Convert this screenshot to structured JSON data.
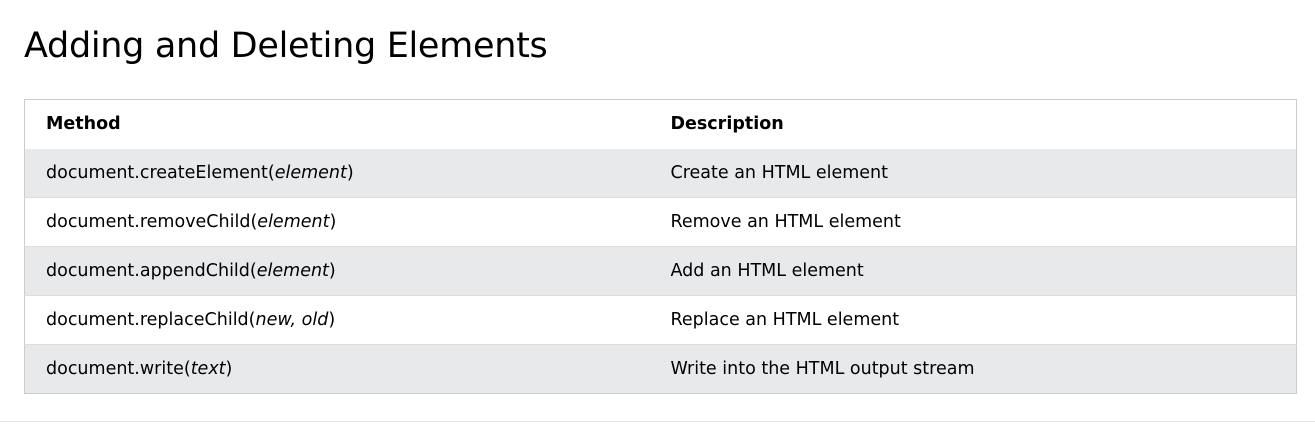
{
  "page": {
    "title": "Adding and Deleting Elements"
  },
  "table": {
    "headers": [
      "Method",
      "Description"
    ],
    "rows": [
      {
        "prefix": "document.createElement(",
        "arg": "element",
        "suffix": ")",
        "description": "Create an HTML element"
      },
      {
        "prefix": "document.removeChild(",
        "arg": "element",
        "suffix": ")",
        "description": "Remove an HTML element"
      },
      {
        "prefix": "document.appendChild(",
        "arg": "element",
        "suffix": ")",
        "description": "Add an HTML element"
      },
      {
        "prefix": "document.replaceChild(",
        "arg": "new, old",
        "suffix": ")",
        "description": "Replace an HTML element"
      },
      {
        "prefix": "document.write(",
        "arg": "text",
        "suffix": ")",
        "description": "Write into the HTML output stream"
      }
    ]
  },
  "colors": {
    "alt_row": "#e7e9eb",
    "border": "#cccccc"
  }
}
